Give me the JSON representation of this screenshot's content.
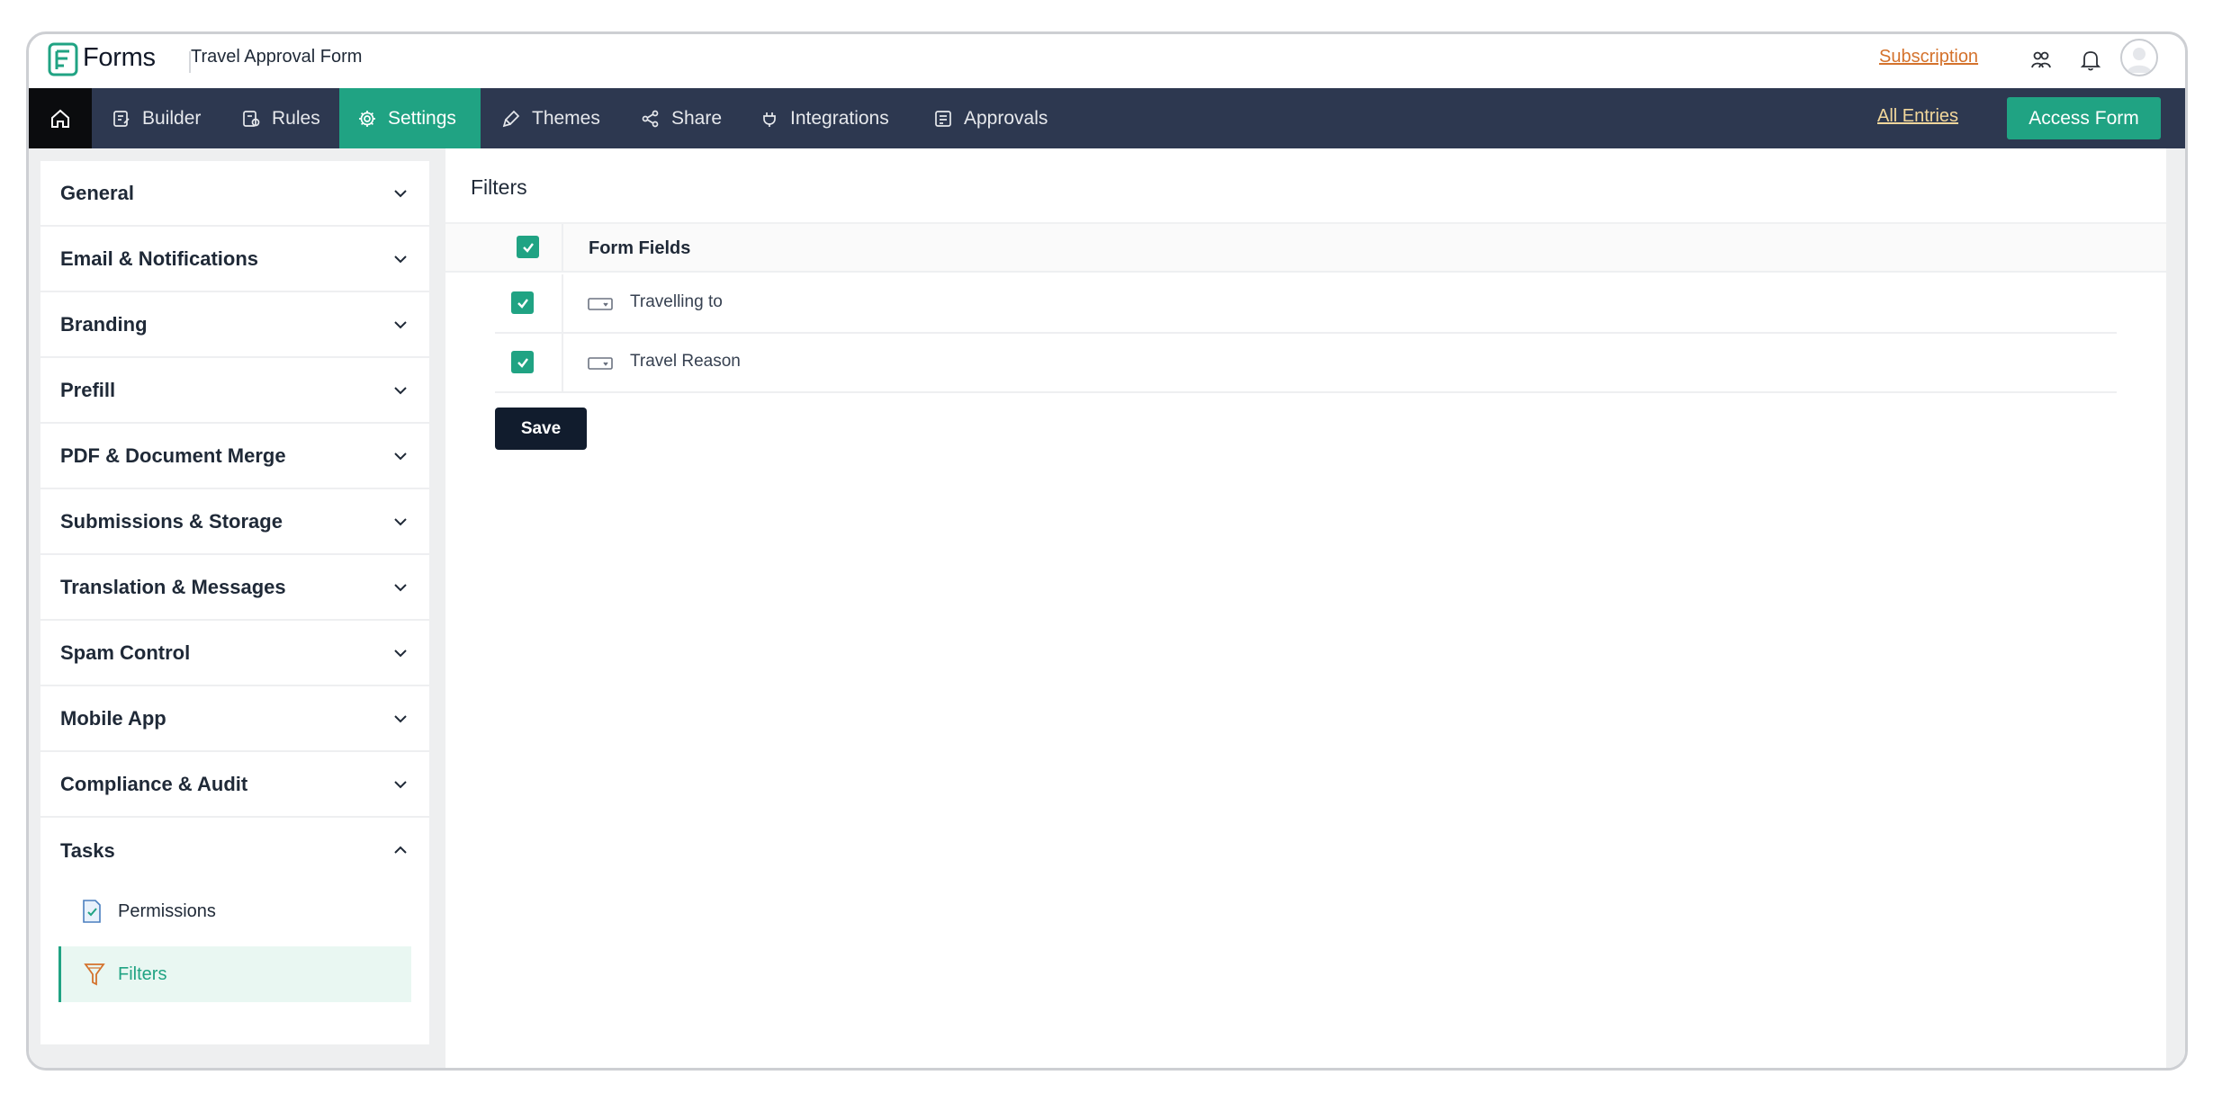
{
  "app": {
    "brand": "Forms",
    "form_title": "Travel Approval Form",
    "subscription_label": "Subscription"
  },
  "icons": {
    "logo": "forms-logo-icon",
    "contacts": "people-icon",
    "notifications": "bell-icon",
    "avatar": "user-avatar"
  },
  "nav": {
    "items": [
      {
        "label": "Builder",
        "icon": "builder-icon"
      },
      {
        "label": "Rules",
        "icon": "rules-icon"
      },
      {
        "label": "Settings",
        "icon": "gear-icon",
        "active": true
      },
      {
        "label": "Themes",
        "icon": "brush-icon"
      },
      {
        "label": "Share",
        "icon": "share-icon"
      },
      {
        "label": "Integrations",
        "icon": "plug-icon"
      },
      {
        "label": "Approvals",
        "icon": "approvals-icon"
      }
    ],
    "all_entries": "All Entries",
    "access_form": "Access Form"
  },
  "sidebar": {
    "sections": [
      {
        "label": "General"
      },
      {
        "label": "Email & Notifications"
      },
      {
        "label": "Branding"
      },
      {
        "label": "Prefill"
      },
      {
        "label": "PDF & Document Merge"
      },
      {
        "label": "Submissions & Storage"
      },
      {
        "label": "Translation & Messages"
      },
      {
        "label": "Spam Control"
      },
      {
        "label": "Mobile App"
      },
      {
        "label": "Compliance & Audit"
      },
      {
        "label": "Tasks",
        "expanded": true
      }
    ],
    "task_items": [
      {
        "label": "Permissions",
        "icon": "permissions-icon"
      },
      {
        "label": "Filters",
        "icon": "filter-icon",
        "active": true
      }
    ]
  },
  "main": {
    "title": "Filters",
    "table": {
      "header": "Form Fields",
      "rows": [
        {
          "label": "Travelling to",
          "checked": true,
          "icon": "dropdown-field-icon"
        },
        {
          "label": "Travel Reason",
          "checked": true,
          "icon": "dropdown-field-icon"
        }
      ]
    },
    "save_label": "Save"
  },
  "colors": {
    "accent": "#20a383",
    "navbar": "#2d3850",
    "subscription": "#d4722c",
    "all_entries": "#f2d79b",
    "save_button": "#111c2d"
  }
}
